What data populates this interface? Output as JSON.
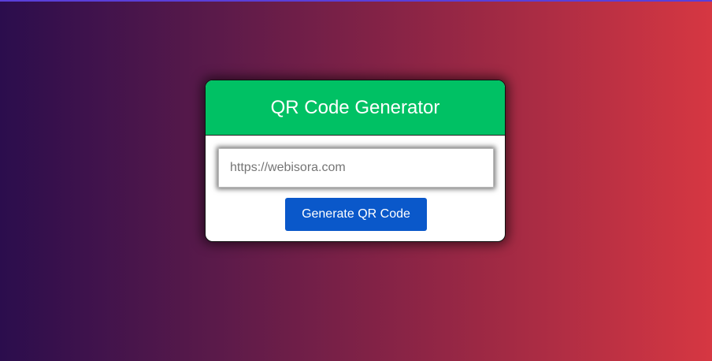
{
  "card": {
    "title": "QR Code Generator",
    "input": {
      "placeholder": "https://webisora.com",
      "value": ""
    },
    "button_label": "Generate QR Code"
  },
  "colors": {
    "header_bg": "#00c164",
    "button_bg": "#0a58ca",
    "gradient_start": "#2b0d4d",
    "gradient_end": "#d63742"
  }
}
